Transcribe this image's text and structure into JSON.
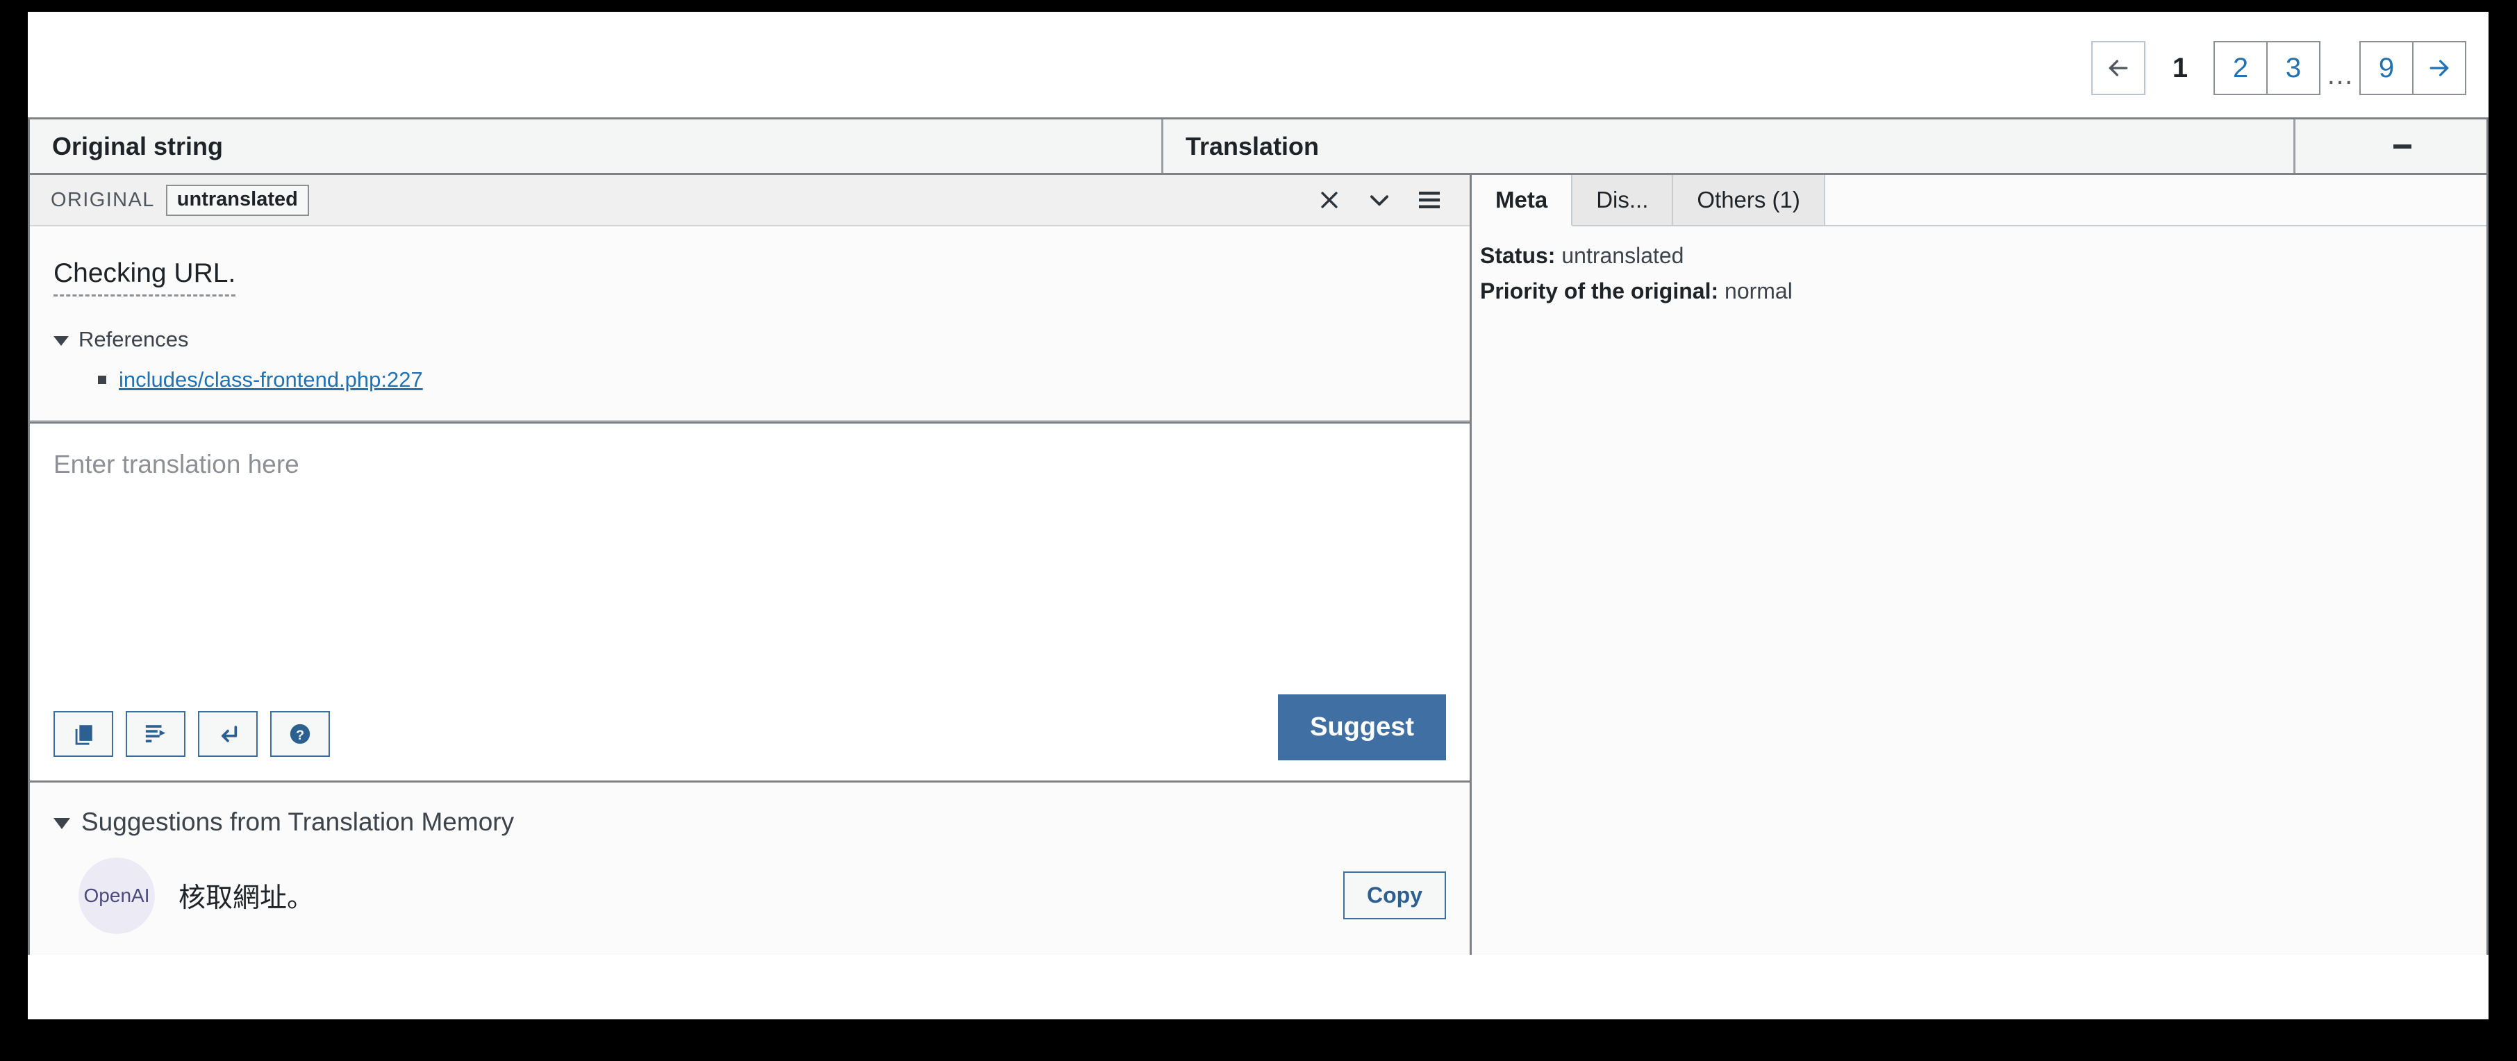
{
  "pagination": {
    "prev_icon": "arrow-left-icon",
    "next_icon": "arrow-right-icon",
    "current_page": "1",
    "pages": [
      "2",
      "3"
    ],
    "ellipsis": "…",
    "last_page": "9"
  },
  "table_header": {
    "original_column": "Original string",
    "translation_column": "Translation",
    "collapse_icon": "minus-icon"
  },
  "row": {
    "original_label": "ORIGINAL",
    "status_badge": "untranslated",
    "icons": {
      "close": "✕",
      "chevron_down": "⌄",
      "menu": "☰"
    },
    "original_text": "Checking URL.",
    "references_header": "References",
    "references": [
      "includes/class-frontend.php:227"
    ],
    "translation_placeholder": "Enter translation here",
    "translation_value": "",
    "toolbar_buttons": [
      {
        "name": "copy-from-original-button",
        "icon": "copy-icon"
      },
      {
        "name": "insert-tab-button",
        "icon": "insert-line-icon"
      },
      {
        "name": "insert-newline-button",
        "icon": "return-arrow-icon"
      },
      {
        "name": "help-button",
        "icon": "question-circle-icon"
      }
    ],
    "suggest_label": "Suggest"
  },
  "translation_memory": {
    "header": "Suggestions from Translation Memory",
    "entries": [
      {
        "source_badge": "OpenAI",
        "text": "核取網址。",
        "copy_label": "Copy"
      }
    ]
  },
  "meta": {
    "tabs": [
      {
        "label": "Meta",
        "active": true
      },
      {
        "label": "Dis...",
        "active": false
      },
      {
        "label": "Others (1)",
        "active": false
      }
    ],
    "fields": [
      {
        "key": "Status:",
        "value": "untranslated"
      },
      {
        "key": "Priority of the original:",
        "value": "normal"
      }
    ]
  },
  "colors": {
    "accent_blue": "#2271b1",
    "suggest_button": "#3f6fa3",
    "badge_lavender": "#ecebf5",
    "badge_text": "#4b4a7a",
    "border_gray": "#7e8287"
  }
}
